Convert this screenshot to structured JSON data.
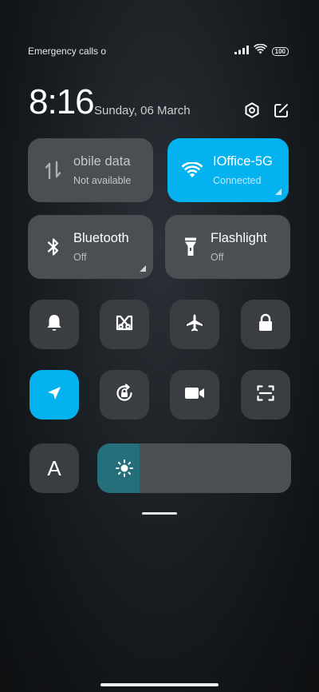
{
  "status_bar": {
    "carrier_text": "Emergency calls o",
    "battery": "100",
    "icons": [
      "signal-icon",
      "wifi-icon",
      "battery-icon"
    ]
  },
  "clock": {
    "time": "8:16",
    "date": "Sunday, 06 March"
  },
  "header_actions": {
    "icons": [
      "settings-icon",
      "edit-icon"
    ]
  },
  "big_tiles": [
    {
      "title": "obile data",
      "status": "Not available",
      "icon": "mobile-data-icon",
      "active": false,
      "has_expand": false
    },
    {
      "title": "IOffice-5G",
      "status": "Connected",
      "icon": "wifi-icon",
      "active": true,
      "has_expand": true
    },
    {
      "title": "Bluetooth",
      "status": "Off",
      "icon": "bluetooth-icon",
      "active": false,
      "has_expand": true
    },
    {
      "title": "Flashlight",
      "status": "Off",
      "icon": "flashlight-icon",
      "active": false,
      "has_expand": false
    }
  ],
  "toggles_row1": [
    {
      "icon": "bell-icon",
      "active": false
    },
    {
      "icon": "screenshot-icon",
      "active": false
    },
    {
      "icon": "airplane-icon",
      "active": false
    },
    {
      "icon": "lock-icon",
      "active": false
    }
  ],
  "toggles_row2": [
    {
      "icon": "location-icon",
      "active": true
    },
    {
      "icon": "rotation-lock-icon",
      "active": false
    },
    {
      "icon": "video-camera-icon",
      "active": false
    },
    {
      "icon": "scanner-icon",
      "active": false
    }
  ],
  "auto_brightness": {
    "label": "A"
  },
  "brightness": {
    "level": 0.22,
    "icon": "sun-icon"
  },
  "colors": {
    "accent": "#04b2ef",
    "tile": "#4a4f53",
    "round_button": "#3a3e42"
  }
}
